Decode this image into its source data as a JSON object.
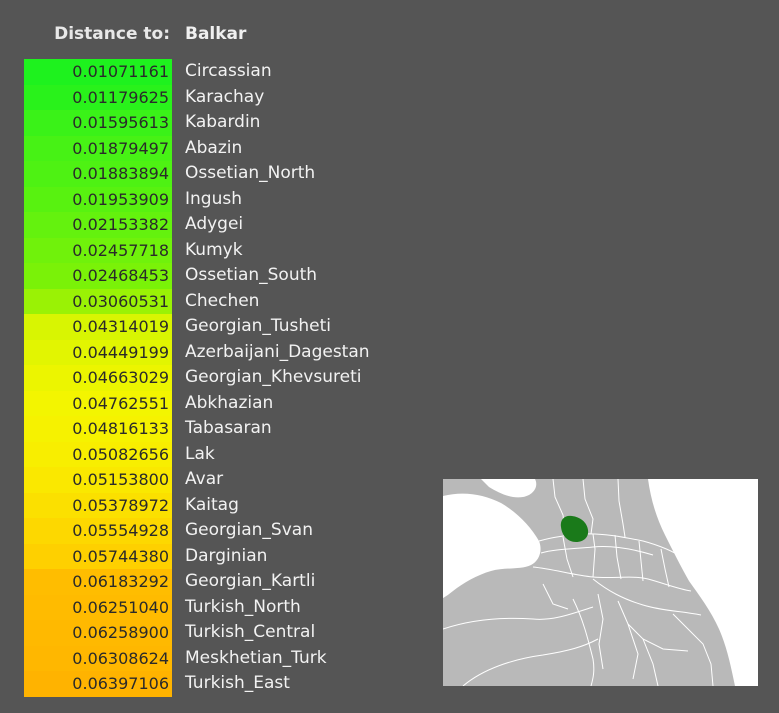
{
  "header": {
    "label": "Distance to:",
    "target": "Balkar"
  },
  "rows": [
    {
      "value": "0.01071161",
      "name": "Circassian",
      "color": "#1ef21e"
    },
    {
      "value": "0.01179625",
      "name": "Karachay",
      "color": "#29f21b"
    },
    {
      "value": "0.01595613",
      "name": "Kabardin",
      "color": "#3af218"
    },
    {
      "value": "0.01879497",
      "name": "Abazin",
      "color": "#47f215"
    },
    {
      "value": "0.01883894",
      "name": "Ossetian_North",
      "color": "#4ef213"
    },
    {
      "value": "0.01953909",
      "name": "Ingush",
      "color": "#58f210"
    },
    {
      "value": "0.02153382",
      "name": "Adygei",
      "color": "#64f20e"
    },
    {
      "value": "0.02457718",
      "name": "Kumyk",
      "color": "#70f20b"
    },
    {
      "value": "0.02468453",
      "name": "Ossetian_South",
      "color": "#7af208"
    },
    {
      "value": "0.03060531",
      "name": "Chechen",
      "color": "#9af205"
    },
    {
      "value": "0.04314019",
      "name": "Georgian_Tusheti",
      "color": "#d8f502"
    },
    {
      "value": "0.04449199",
      "name": "Azerbaijani_Dagestan",
      "color": "#e2f501"
    },
    {
      "value": "0.04663029",
      "name": "Georgian_Khevsureti",
      "color": "#ecf500"
    },
    {
      "value": "0.04762551",
      "name": "Abkhazian",
      "color": "#f3f500"
    },
    {
      "value": "0.04816133",
      "name": "Tabasaran",
      "color": "#f6f200"
    },
    {
      "value": "0.05082656",
      "name": "Lak",
      "color": "#f8ee00"
    },
    {
      "value": "0.05153800",
      "name": "Avar",
      "color": "#fae800"
    },
    {
      "value": "0.05378972",
      "name": "Kaitag",
      "color": "#fbe000"
    },
    {
      "value": "0.05554928",
      "name": "Georgian_Svan",
      "color": "#fdd800"
    },
    {
      "value": "0.05744380",
      "name": "Darginian",
      "color": "#fed000"
    },
    {
      "value": "0.06183292",
      "name": "Georgian_Kartli",
      "color": "#ffbd00"
    },
    {
      "value": "0.06251040",
      "name": "Turkish_North",
      "color": "#ffbb00"
    },
    {
      "value": "0.06258900",
      "name": "Turkish_Central",
      "color": "#ffb900"
    },
    {
      "value": "0.06308624",
      "name": "Meskhetian_Turk",
      "color": "#ffb700"
    },
    {
      "value": "0.06397106",
      "name": "Turkish_East",
      "color": "#ffb300"
    }
  ],
  "map": {
    "land_color": "#b9b9b9",
    "sea_color": "#ffffff",
    "border_color": "#ffffff",
    "highlight_color": "#1a7a1a"
  }
}
